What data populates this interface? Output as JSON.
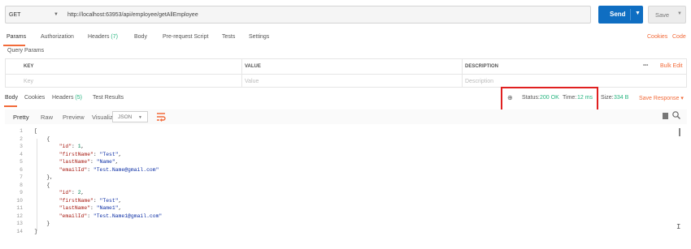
{
  "request": {
    "method": "GET",
    "url": "http://localhost:63953/api/employee/getAllEmployee",
    "send_label": "Send",
    "save_label": "Save"
  },
  "req_tabs": [
    {
      "label": "Params",
      "active": true
    },
    {
      "label": "Authorization"
    },
    {
      "label": "Headers",
      "count": "(7)"
    },
    {
      "label": "Body"
    },
    {
      "label": "Pre-request Script"
    },
    {
      "label": "Tests"
    },
    {
      "label": "Settings"
    }
  ],
  "links": {
    "cookies": "Cookies",
    "code": "Code"
  },
  "query_params": {
    "title": "Query Params",
    "columns": {
      "key": "KEY",
      "value": "VALUE",
      "description": "DESCRIPTION"
    },
    "placeholders": {
      "key": "Key",
      "value": "Value",
      "description": "Description"
    },
    "more": "•••",
    "bulk_edit": "Bulk Edit"
  },
  "resp_tabs": [
    {
      "label": "Body",
      "active": true
    },
    {
      "label": "Cookies"
    },
    {
      "label": "Headers",
      "count": "(5)"
    },
    {
      "label": "Test Results"
    }
  ],
  "response_meta": {
    "status_label": "Status:",
    "status_value": "200 OK",
    "time_label": "Time:",
    "time_value": "12 ms",
    "size_label": "Size:",
    "size_value": "334 B",
    "save_response": "Save Response"
  },
  "viewer": {
    "modes": [
      "Pretty",
      "Raw",
      "Preview",
      "Visualize"
    ],
    "format": "JSON"
  },
  "colors": {
    "accent": "#f26b3a",
    "send": "#0f6ec2",
    "success": "#26b47f",
    "highlight": "#e02020"
  },
  "code_lines": [
    {
      "n": "1",
      "text": "["
    },
    {
      "n": "2",
      "text": "    {"
    },
    {
      "n": "3",
      "key": "\"id\"",
      "val": "1",
      "type": "num",
      "trail": ","
    },
    {
      "n": "4",
      "key": "\"firstName\"",
      "val": "\"Test\"",
      "type": "str",
      "trail": ","
    },
    {
      "n": "5",
      "key": "\"lastName\"",
      "val": "\"Name\"",
      "type": "str",
      "trail": ","
    },
    {
      "n": "6",
      "key": "\"emailId\"",
      "val": "\"Test.Name@gmail.com\"",
      "type": "str",
      "trail": ""
    },
    {
      "n": "7",
      "text": "    },"
    },
    {
      "n": "8",
      "text": "    {"
    },
    {
      "n": "9",
      "key": "\"id\"",
      "val": "2",
      "type": "num",
      "trail": ","
    },
    {
      "n": "10",
      "key": "\"firstName\"",
      "val": "\"Test\"",
      "type": "str",
      "trail": ","
    },
    {
      "n": "11",
      "key": "\"lastName\"",
      "val": "\"Name1\"",
      "type": "str",
      "trail": ","
    },
    {
      "n": "12",
      "key": "\"emailId\"",
      "val": "\"Test.Name1@gmail.com\"",
      "type": "str",
      "trail": ""
    },
    {
      "n": "13",
      "text": "    }"
    },
    {
      "n": "14",
      "text": "]"
    }
  ]
}
